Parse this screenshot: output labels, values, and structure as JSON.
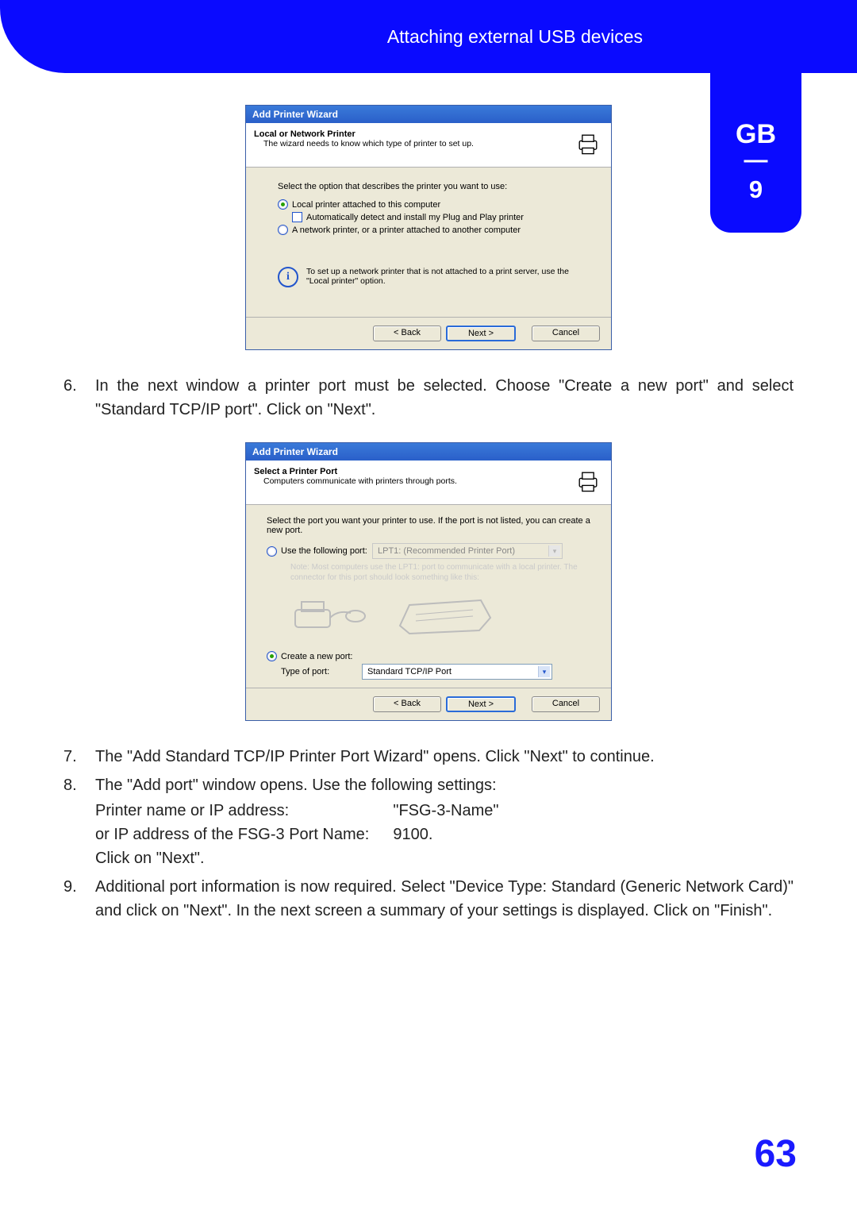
{
  "header": {
    "title": "Attaching external USB devices",
    "language": "GB",
    "chapter": "9"
  },
  "page_number": "63",
  "wizard1": {
    "window_title": "Add Printer Wizard",
    "heading": "Local or Network Printer",
    "subheading": "The wizard needs to know which type of printer to set up.",
    "prompt": "Select the option that describes the printer you want to use:",
    "opt_local": "Local printer attached to this computer",
    "opt_auto": "Automatically detect and install my Plug and Play printer",
    "opt_network": "A network printer, or a printer attached to another computer",
    "info": "To set up a network printer that is not attached to a print server, use the \"Local printer\" option.",
    "btn_back": "< Back",
    "btn_next": "Next >",
    "btn_cancel": "Cancel"
  },
  "wizard2": {
    "window_title": "Add Printer Wizard",
    "heading": "Select a Printer Port",
    "subheading": "Computers communicate with printers through ports.",
    "prompt": "Select the port you want your printer to use.  If the port is not listed, you can create a new port.",
    "opt_use": "Use the following port:",
    "port_default": "LPT1: (Recommended Printer Port)",
    "note": "Note: Most computers use the LPT1: port to communicate with a local printer. The connector for this port should look something like this:",
    "opt_create": "Create a new port:",
    "type_label": "Type of port:",
    "type_value": "Standard TCP/IP Port",
    "btn_back": "< Back",
    "btn_next": "Next >",
    "btn_cancel": "Cancel"
  },
  "steps": {
    "s6": {
      "num": "6.",
      "text": "In the next window a printer port must be selected. Choose \"Create a new port\" and select \"Standard TCP/IP port\". Click on \"Next\"."
    },
    "s7": {
      "num": "7.",
      "text": "The \"Add Standard TCP/IP Printer Port Wizard\" opens. Click \"Next\" to continue."
    },
    "s8": {
      "num": "8.",
      "intro": "The \"Add port\" window opens. Use the following settings:",
      "row1_l": "Printer name or IP address:",
      "row1_v": "\"FSG-3-Name\"",
      "row2_l": "or IP address of the FSG-3 Port Name:",
      "row2_v": "9100.",
      "out": "Click on \"Next\"."
    },
    "s9": {
      "num": "9.",
      "text": "Additional port information is now required. Select \"Device Type: Standard (Generic Network Card)\" and click on \"Next\". In the next screen a summary of your settings is displayed. Click on \"Finish\"."
    }
  }
}
